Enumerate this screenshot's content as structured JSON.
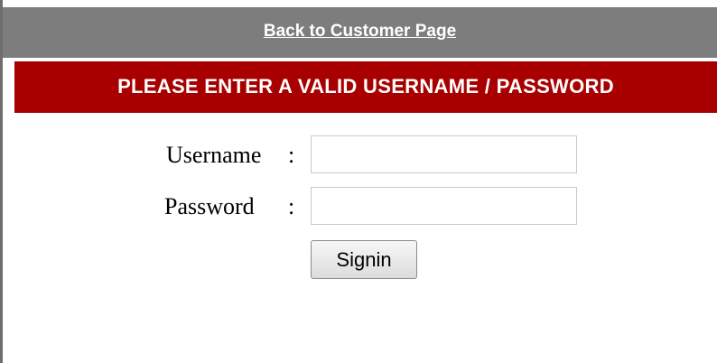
{
  "header": {
    "back_link_label": "Back to Customer Page"
  },
  "error": {
    "message": "PLEASE ENTER A VALID USERNAME / PASSWORD"
  },
  "form": {
    "username_label": "Username",
    "password_label": "Password",
    "separator": ":",
    "username_value": "",
    "password_value": "",
    "signin_label": "Signin"
  },
  "colors": {
    "top_bar": "#7d7d7d",
    "error_bar": "#a80000",
    "text_on_bar": "#ffffff"
  }
}
